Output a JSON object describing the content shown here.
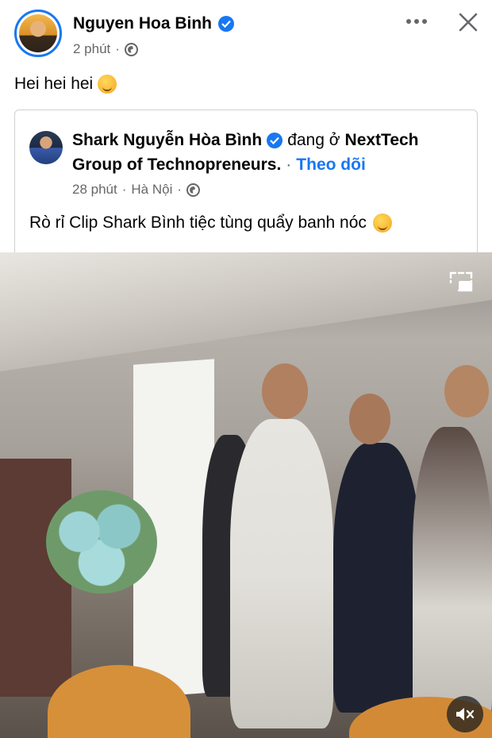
{
  "post": {
    "author": "Nguyen Hoa Binh",
    "time": "2 phút",
    "caption": "Hei hei hei",
    "caption_emoji": "partying-face-emoji"
  },
  "shared_post": {
    "author": "Shark Nguyễn Hòa Bình",
    "at_text": "đang ở",
    "place_part1": "NextTech",
    "place_part2": "Group of Technopreneurs.",
    "separator": "·",
    "follow_label": "Theo dõi",
    "time": "28 phút",
    "location": "Hà Nội",
    "text": "Rò rỉ Clip Shark Bình tiệc tùng quẩy banh nóc",
    "text_emoji": "smirking-face-emoji"
  },
  "icons": {
    "verified": "verified-badge-icon",
    "privacy": "globe-icon",
    "more": "more-options-icon",
    "close": "close-icon",
    "pip": "picture-in-picture-icon",
    "mute": "muted-speaker-icon"
  },
  "colors": {
    "accent": "#1877f2",
    "secondary_text": "#65676b",
    "primary_text": "#050505"
  }
}
